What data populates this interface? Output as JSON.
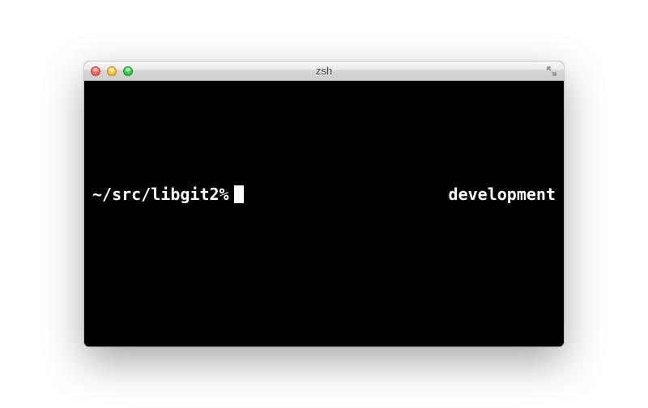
{
  "window": {
    "title": "zsh"
  },
  "terminal": {
    "prompt_left": "~/src/libgit2%",
    "prompt_right": "development"
  }
}
